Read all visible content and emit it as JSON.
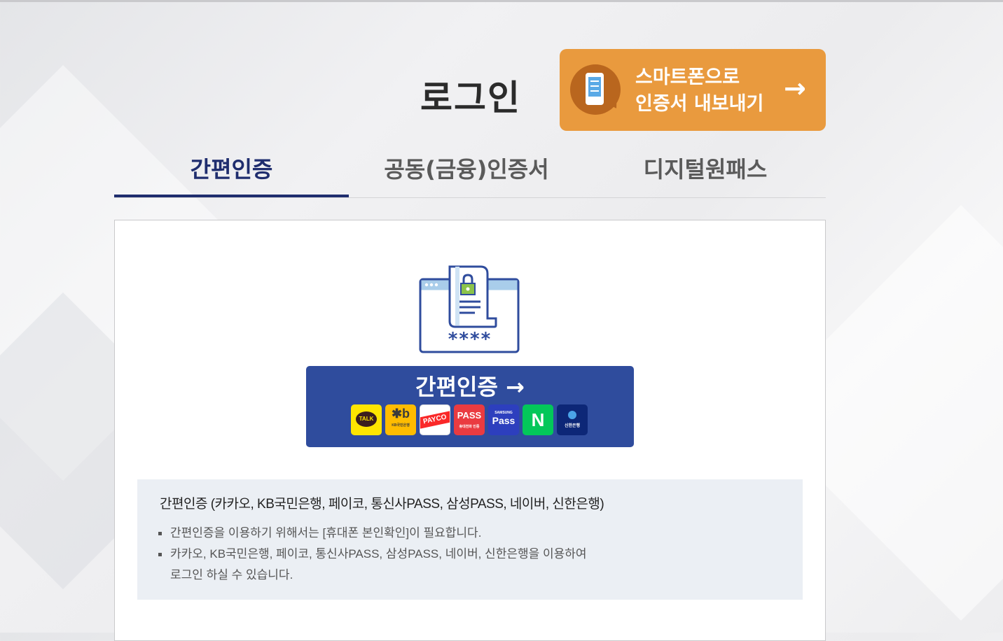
{
  "page": {
    "title": "로그인"
  },
  "export_button": {
    "line1": "스마트폰으로",
    "line2": "인증서 내보내기",
    "arrow": "→",
    "icon": "smartphone-icon"
  },
  "tabs": [
    {
      "label": "간편인증",
      "active": true
    },
    {
      "label": "공동(금융)인증서",
      "active": false
    },
    {
      "label": "디지털원패스",
      "active": false
    }
  ],
  "auth_button": {
    "label": "간편인증",
    "arrow": "→",
    "providers": [
      {
        "name": "kakao",
        "text": "TALK",
        "color": "#fee500"
      },
      {
        "name": "kb",
        "text": "KB국민은행",
        "color": "#ffbc00"
      },
      {
        "name": "payco",
        "text": "PAYCO",
        "color": "#fa2828"
      },
      {
        "name": "pass",
        "text": "PASS",
        "sub": "휴대전화 인증",
        "color": "#ea3b41"
      },
      {
        "name": "samsung-pass",
        "text": "Pass",
        "sub": "SAMSUNG",
        "color": "#2d3fbe"
      },
      {
        "name": "naver",
        "text": "N",
        "color": "#03c75a"
      },
      {
        "name": "shinhan",
        "text": "신한은행",
        "color": "#0d2777"
      }
    ]
  },
  "hero": {
    "masked": "****"
  },
  "info": {
    "title": "간편인증 (카카오, KB국민은행, 페이코, 통신사PASS, 삼성PASS, 네이버, 신한은행)",
    "items": [
      "간편인증을 이용하기 위해서는 [휴대폰 본인확인]이 필요합니다.",
      "카카오, KB국민은행, 페이코, 통신사PASS, 삼성PASS, 네이버, 신한은행을 이용하여",
      "로그인 하실 수 있습니다."
    ]
  },
  "colors": {
    "accent": "#e99a3e",
    "primary": "#2f4c9d",
    "tab_active": "#1f2d6e"
  }
}
